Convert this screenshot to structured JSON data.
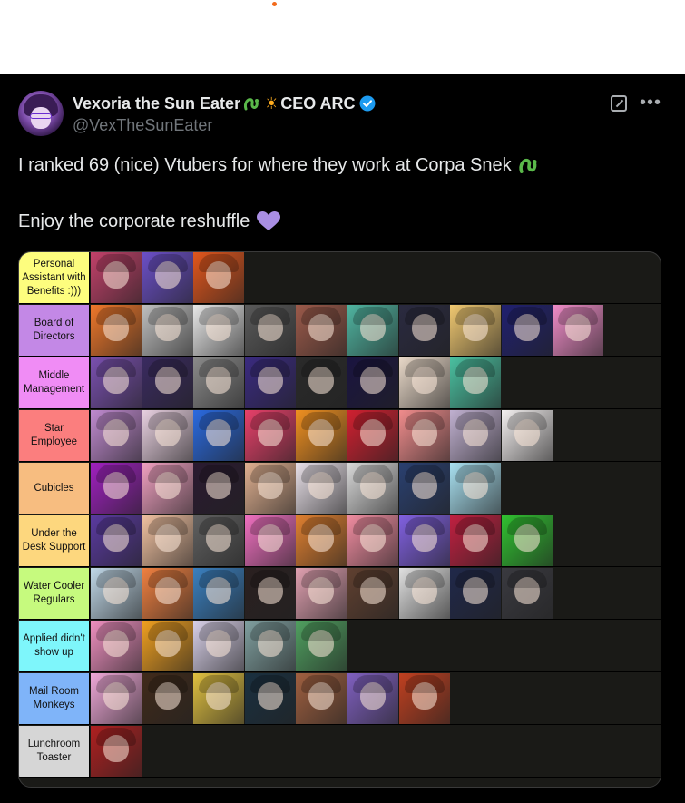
{
  "post": {
    "display_name": "Vexoria the Sun Eater",
    "title_suffix": "CEO ARC",
    "handle": "@VexTheSunEater",
    "text_line1": "I ranked 69 (nice) Vtubers for where they work at Corpa Snek",
    "text_line2": "Enjoy the corporate reshuffle",
    "icons": [
      "snake-emoji-icon",
      "sun-emoji-icon",
      "verified-badge-icon",
      "edit-icon",
      "more-icon",
      "purple-heart-icon"
    ]
  },
  "tiers": [
    {
      "label": "Personal Assistant with Benefits :)))",
      "color": "#fdfd7e",
      "count": 3,
      "thumbs": [
        "#c2416a",
        "#6b4fc8",
        "#e2561c"
      ]
    },
    {
      "label": "Board of Directors",
      "color": "#c388e6",
      "count": 10,
      "thumbs": [
        "#f0782a",
        "#bfbfbf",
        "#e8e8e8",
        "#5a5a5a",
        "#9c5a4a",
        "#4fb4a0",
        "#2a2a40",
        "#f0c870",
        "#202070",
        "#f08cc8"
      ]
    },
    {
      "label": "Middle Management",
      "color": "#f08cf5",
      "count": 8,
      "thumbs": [
        "#7a50b0",
        "#3a2a60",
        "#8a8a8a",
        "#3a2a80",
        "#2a2a2a",
        "#1a1440",
        "#e8d8c8",
        "#4ac0a0"
      ]
    },
    {
      "label": "Star Employee",
      "color": "#fb7e7e",
      "count": 9,
      "thumbs": [
        "#c08ad0",
        "#e8d0e0",
        "#2a6ae0",
        "#e8406a",
        "#f09020",
        "#d02030",
        "#f08c8c",
        "#c0b0d0",
        "#f4f0f0"
      ]
    },
    {
      "label": "Cubicles",
      "color": "#f7bd80",
      "count": 8,
      "thumbs": [
        "#a020c0",
        "#f0a0c0",
        "#2a1a30",
        "#e0b090",
        "#e8e0e8",
        "#d8d8d8",
        "#2a4070",
        "#a8e0f0"
      ]
    },
    {
      "label": "Under the Desk Support",
      "color": "#fdd77e",
      "count": 9,
      "thumbs": [
        "#5a3aa0",
        "#f0c0a0",
        "#606060",
        "#f070c0",
        "#e08030",
        "#f08ca0",
        "#8060e0",
        "#c02040",
        "#30c030"
      ]
    },
    {
      "label": "Water Cooler Regulars",
      "color": "#c6fa7e",
      "count": 9,
      "thumbs": [
        "#c0d8e8",
        "#f08040",
        "#3a80c0",
        "#2a2020",
        "#e0a0b0",
        "#604030",
        "#e0e0e0",
        "#20284a",
        "#3a3a40"
      ]
    },
    {
      "label": "Applied didn't show up",
      "color": "#7ef6fb",
      "count": 5,
      "thumbs": [
        "#f090c0",
        "#f0a020",
        "#d8d0e8",
        "#80a0a0",
        "#50a060"
      ]
    },
    {
      "label": "Mail Room Monkeys",
      "color": "#7fb4f9",
      "count": 7,
      "thumbs": [
        "#f0a8d8",
        "#402a1a",
        "#e0c040",
        "#1a3040",
        "#a06040",
        "#8060c0",
        "#c04020"
      ]
    },
    {
      "label": "Lunchroom Toaster",
      "color": "#d6d6d6",
      "count": 1,
      "thumbs": [
        "#b02020"
      ]
    }
  ]
}
